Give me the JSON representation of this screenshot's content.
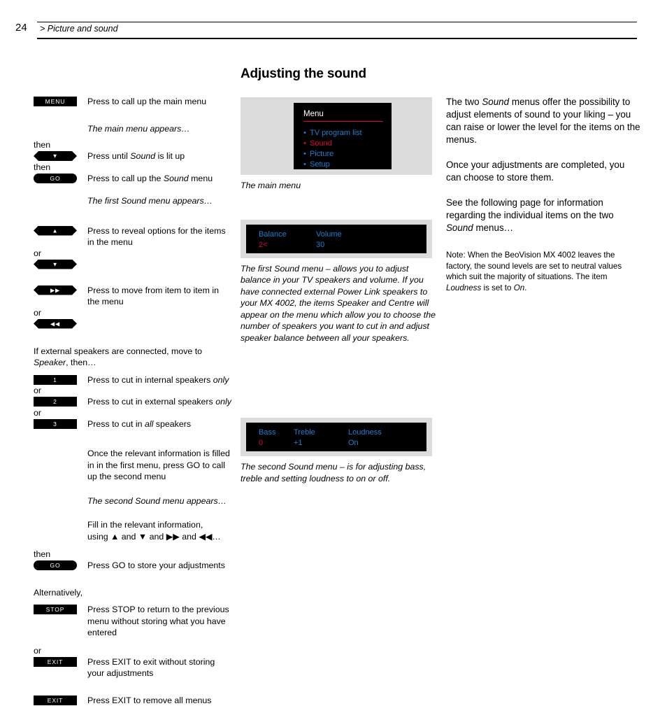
{
  "header": {
    "page_number": "24",
    "breadcrumb": "> Picture and sound"
  },
  "main": {
    "title": "Adjusting the sound"
  },
  "left_column": {
    "steps": [
      {
        "key": "MENU",
        "key_shape": "rect",
        "text": "Press to call up the main menu"
      },
      {
        "note": "The main menu appears…"
      },
      {
        "connector": "then"
      },
      {
        "key": "▼",
        "key_shape": "hex",
        "text": "Press until Sound is lit up",
        "em_word": "Sound"
      },
      {
        "connector": "then"
      },
      {
        "key": "GO",
        "key_shape": "pill",
        "text": "Press to call up the Sound menu",
        "em_word": "Sound"
      },
      {
        "note": "The first Sound menu appears…"
      },
      {
        "key": "▲",
        "key_shape": "hex",
        "text": "Press to reveal options for the items in the menu"
      },
      {
        "connector": "or"
      },
      {
        "key": "▼",
        "key_shape": "hex"
      },
      {
        "key": "▶▶",
        "key_shape": "hex",
        "text": "Press to move from item to item in the menu"
      },
      {
        "connector": "or"
      },
      {
        "key": "◀◀",
        "key_shape": "hex"
      }
    ],
    "speaker_intro_line1": "If external speakers are connected, move to",
    "speaker_intro_line2_italic": "Speaker",
    "speaker_intro_line2_rest": ", then…",
    "speaker_steps": [
      {
        "key": "1",
        "key_shape": "rect",
        "text_before": "Press to cut in internal speakers ",
        "text_em": "only"
      },
      {
        "connector": "or"
      },
      {
        "key": "2",
        "key_shape": "rect",
        "text_before": "Press to cut in external speakers ",
        "text_em": "only"
      },
      {
        "connector": "or"
      },
      {
        "key": "3",
        "key_shape": "rect",
        "text_before": "Press to cut in ",
        "text_em": "all",
        "text_after": " speakers"
      }
    ],
    "second_menu_instruction": "Once the relevant information is filled in in the first menu, press GO to call up the second menu",
    "second_menu_note": "The second Sound menu appears…",
    "fill_in_line1": "Fill in the relevant information,",
    "fill_in_line2": "using ▲ and ▼ and ▶▶ and ◀◀…",
    "store_connector": "then",
    "store_key": "GO",
    "store_text": "Press GO to store your adjustments",
    "alternatively": "Alternatively,",
    "stop_key": "STOP",
    "stop_text": "Press STOP to return to the previous menu without storing what you have entered",
    "or_connector": "or",
    "exit_key_1": "EXIT",
    "exit_text_1": "Press EXIT to exit without storing your adjustments",
    "exit_key_2": "EXIT",
    "exit_text_2": "Press EXIT to remove all menus"
  },
  "mid_column": {
    "main_menu": {
      "title": "Menu",
      "items": [
        {
          "label": "TV program list",
          "active": false
        },
        {
          "label": "Sound",
          "active": true
        },
        {
          "label": "Picture",
          "active": false
        },
        {
          "label": "Setup",
          "active": false
        }
      ]
    },
    "main_menu_caption": "The main menu",
    "first_sound_menu": {
      "columns": [
        {
          "label": "Balance",
          "value": "2<",
          "value_hot": true
        },
        {
          "label": "Volume",
          "value": "30",
          "value_hot": false
        }
      ]
    },
    "first_sound_caption": "The first Sound menu – allows you to adjust balance in your TV speakers and volume. If you have connected external Power Link speakers to your MX 4002, the items Speaker and Centre will appear on the menu which allow you to choose the number of speakers you want to cut in and adjust speaker balance between all your speakers.",
    "second_sound_menu": {
      "columns": [
        {
          "label": "Bass",
          "value": "0",
          "value_hot": true
        },
        {
          "label": "Treble",
          "value": "+1",
          "value_hot": false
        },
        {
          "label": "Loudness",
          "value": "On",
          "value_hot": false
        }
      ]
    },
    "second_sound_caption": "The second Sound menu – is for adjusting bass, treble and setting loudness to on or off."
  },
  "right_column": {
    "paragraph_1_a": "The two ",
    "paragraph_1_em": "Sound",
    "paragraph_1_b": " menus offer the possibility to adjust elements of sound to your liking – you can raise or lower the level for the items on the menus.",
    "paragraph_2": "Once your adjustments are completed, you can choose to store them.",
    "paragraph_3_a": "See the following page for information regarding the individual items on the two ",
    "paragraph_3_em": "Sound",
    "paragraph_3_b": " menus…",
    "note_a": "Note: When the BeoVision MX 4002 leaves the factory, the sound levels are set to neutral values which suit the majority of situations. The item ",
    "note_em_1": "Loudness",
    "note_b": " is set to ",
    "note_em_2": "On",
    "note_c": "."
  },
  "colors": {
    "menu_blue": "#1b7fd4",
    "menu_red": "#e4003c",
    "screen_bg": "#000000",
    "frame_gray": "#dcdcdc"
  }
}
